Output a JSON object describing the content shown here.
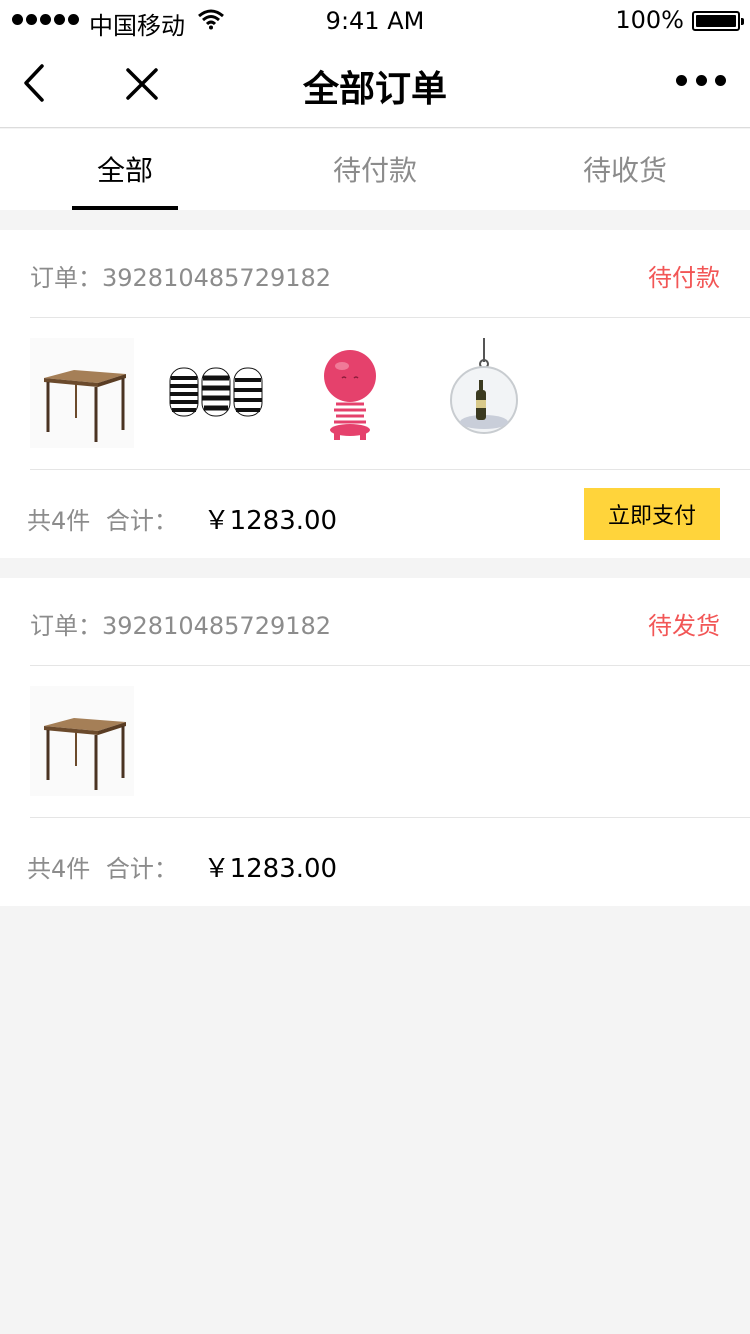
{
  "status_bar": {
    "carrier": "中国移动",
    "time": "9:41 AM",
    "battery": "100%"
  },
  "nav": {
    "title": "全部订单",
    "back_icon": "chevron-left-icon",
    "close_icon": "close-icon",
    "more_icon": "more-icon"
  },
  "tabs": [
    {
      "label": "全部",
      "active": true
    },
    {
      "label": "待付款",
      "active": false
    },
    {
      "label": "待收货",
      "active": false
    }
  ],
  "orders": [
    {
      "label": "订单：",
      "number": "392810485729182",
      "status": "待付款",
      "items": [
        "wooden-table-image",
        "striped-vases-image",
        "pink-spring-figure-image",
        "hanging-bubble-bottle-image"
      ],
      "count_text": "共4件",
      "total_label": "合计：",
      "total": "￥1283.00",
      "action_label": "立即支付"
    },
    {
      "label": "订单：",
      "number": "392810485729182",
      "status": "待发货",
      "items": [
        "wooden-table-image"
      ],
      "count_text": "共4件",
      "total_label": "合计：",
      "total": "￥1283.00"
    }
  ],
  "colors": {
    "accent_yellow": "#ffd43b",
    "status_red": "#f25656",
    "muted_text": "#8c8c8c",
    "background": "#f4f4f4"
  }
}
